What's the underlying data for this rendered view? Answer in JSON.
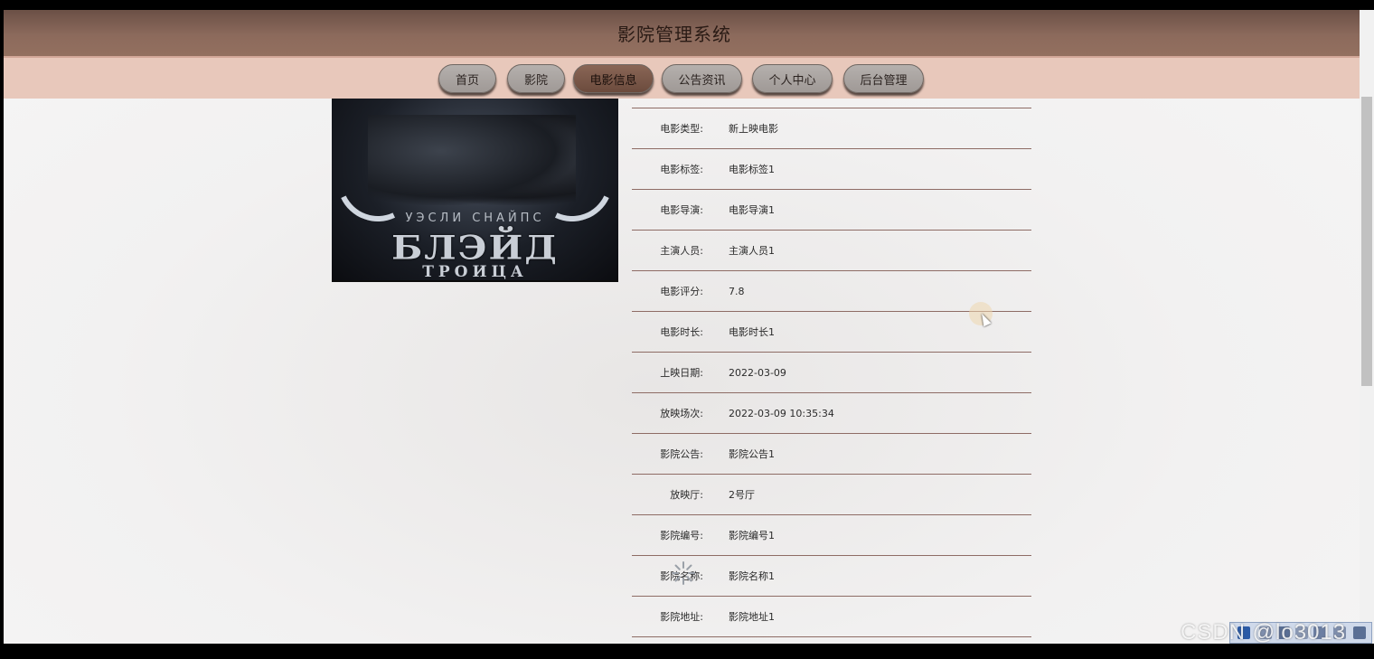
{
  "header": {
    "title": "影院管理系统"
  },
  "nav": {
    "items": [
      {
        "label": "首页",
        "active": false
      },
      {
        "label": "影院",
        "active": false
      },
      {
        "label": "电影信息",
        "active": true
      },
      {
        "label": "公告资讯",
        "active": false
      },
      {
        "label": "个人中心",
        "active": false
      },
      {
        "label": "后台管理",
        "active": false
      }
    ]
  },
  "poster": {
    "line1": "УЭСЛИ СНАЙПС",
    "line2": "БЛЭЙД",
    "line3": "ТРОИЦА"
  },
  "details": [
    {
      "label": "电影类型:",
      "value": "新上映电影"
    },
    {
      "label": "电影标签:",
      "value": "电影标签1"
    },
    {
      "label": "电影导演:",
      "value": "电影导演1"
    },
    {
      "label": "主演人员:",
      "value": "主演人员1"
    },
    {
      "label": "电影评分:",
      "value": "7.8"
    },
    {
      "label": "电影时长:",
      "value": "电影时长1"
    },
    {
      "label": "上映日期:",
      "value": "2022-03-09"
    },
    {
      "label": "放映场次:",
      "value": "2022-03-09 10:35:34"
    },
    {
      "label": "影院公告:",
      "value": "影院公告1"
    },
    {
      "label": "放映厅:",
      "value": "2号厅"
    },
    {
      "label": "影院编号:",
      "value": "影院编号1"
    },
    {
      "label": "影院名称:",
      "value": "影院名称1"
    },
    {
      "label": "影院地址:",
      "value": "影院地址1"
    }
  ],
  "watermark": "CSDN @lo3013",
  "colors": {
    "header_dark": "#6b5046",
    "nav_bg": "#e8c8bb",
    "nav_pill": "#a8a29f",
    "nav_active": "#7b5a4b",
    "row_divider": "#8e6c65"
  }
}
